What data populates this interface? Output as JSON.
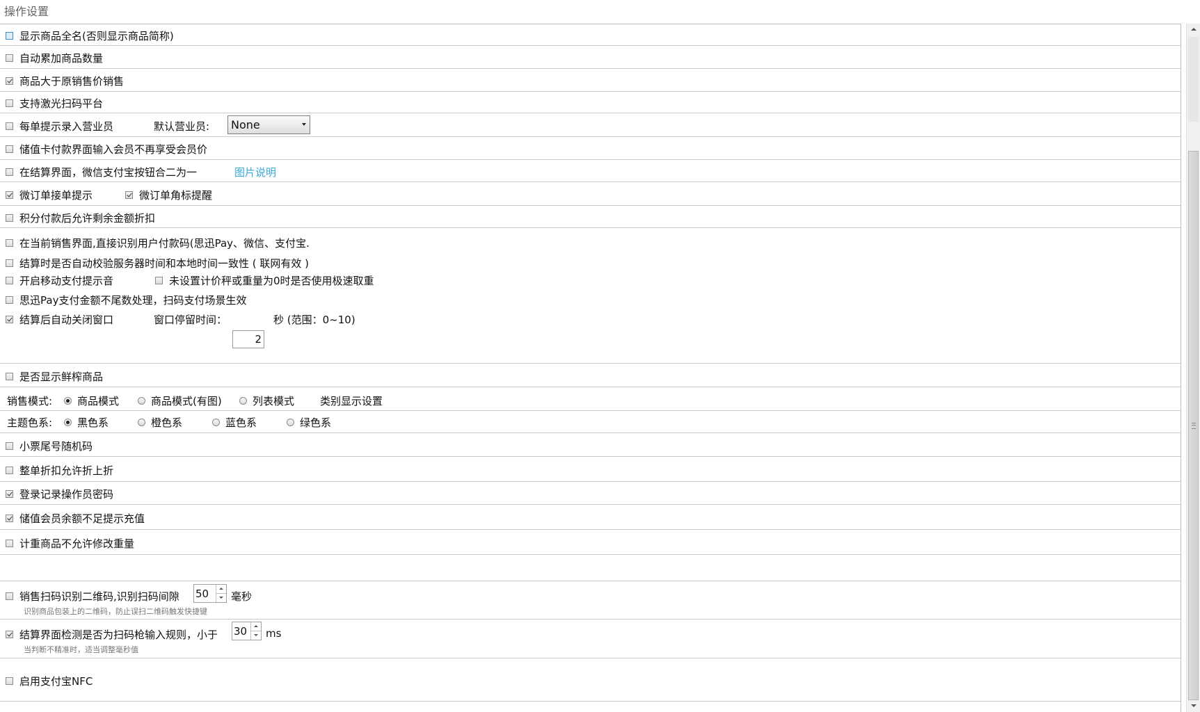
{
  "title": "操作设置",
  "rows": {
    "r1": {
      "label": "显示商品全名(否则显示商品简称)",
      "checked": false
    },
    "r2": {
      "label": "自动累加商品数量",
      "checked": false
    },
    "r3": {
      "label": "商品大于原销售价销售",
      "checked": true
    },
    "r4": {
      "label": "支持激光扫码平台",
      "checked": false
    },
    "r5": {
      "label": "每单提示录入营业员",
      "checked": false,
      "default_label": "默认营业员:",
      "select_value": "None"
    },
    "r6": {
      "label": "储值卡付款界面输入会员不再享受会员价",
      "checked": false
    },
    "r7": {
      "label": "在结算界面，微信支付宝按钮合二为一",
      "checked": false,
      "link": "图片说明"
    },
    "r8": {
      "label": "微订单接单提示",
      "checked": true,
      "label2": "微订单角标提醒",
      "checked2": true
    },
    "r9": {
      "label": "积分付款后允许剩余金额折扣",
      "checked": false
    },
    "r10": {
      "label": "在当前销售界面,直接识别用户付款码(思迅Pay、微信、支付宝.",
      "checked": false
    },
    "r11": {
      "label": "结算时是否自动校验服务器时间和本地时间一致性 ( 联网有效 )",
      "checked": false
    },
    "r12": {
      "label": "开启移动支付提示音",
      "checked": false,
      "label2": "未设置计价秤或重量为0时是否使用极速取重",
      "checked2": false
    },
    "r13": {
      "label": "思迅Pay支付金额不尾数处理，扫码支付场景生效",
      "checked": false
    },
    "r14": {
      "label": "结算后自动关闭窗口",
      "checked": true,
      "stay_label": "窗口停留时间：",
      "stay_value": "2",
      "stay_unit": "秒 (范围：0~10)"
    },
    "r15": {
      "label": "是否显示鲜榨商品",
      "checked": false
    },
    "sales_mode": {
      "label": "销售模式:",
      "options": [
        "商品模式",
        "商品模式(有图)",
        "列表模式"
      ],
      "selected": "商品模式",
      "category_setting": "类别显示设置"
    },
    "theme": {
      "label": "主题色系:",
      "options": [
        "黑色系",
        "橙色系",
        "蓝色系",
        "绿色系"
      ],
      "selected": "黑色系"
    },
    "r18": {
      "label": "小票尾号随机码",
      "checked": false
    },
    "r19": {
      "label": "整单折扣允许折上折",
      "checked": false
    },
    "r20": {
      "label": "登录记录操作员密码",
      "checked": true
    },
    "r21": {
      "label": "储值会员余额不足提示充值",
      "checked": true
    },
    "r22": {
      "label": "计重商品不允许修改重量",
      "checked": false
    },
    "r23": {
      "label": "销售扫码识别二维码,识别扫码间隙",
      "checked": false,
      "value": "50",
      "unit": "毫秒",
      "hint": "识别商品包装上的二维码，防止误扫二维码触发快捷键"
    },
    "r24": {
      "label": "结算界面检测是否为扫码枪输入规则，小于",
      "checked": true,
      "value": "30",
      "unit": "ms",
      "hint": "当判断不精准时，适当调整毫秒值"
    },
    "r25": {
      "label": "启用支付宝NFC",
      "checked": false
    }
  }
}
